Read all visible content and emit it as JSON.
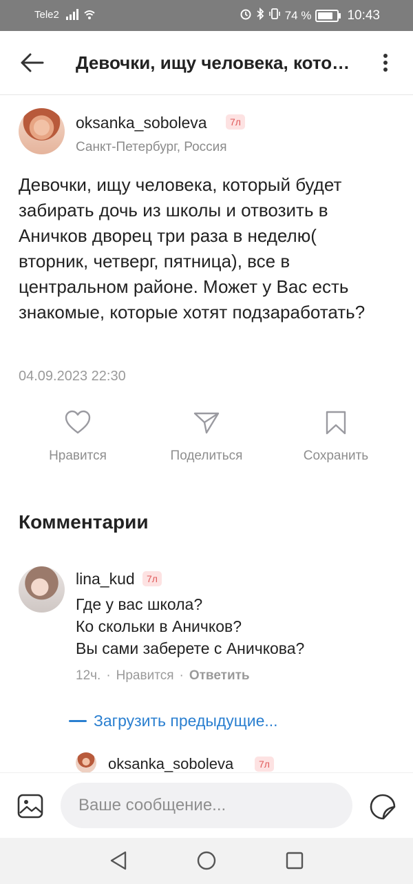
{
  "status_bar": {
    "carrier": "Tele2",
    "battery": "74 %",
    "time": "10:43"
  },
  "header": {
    "title": "Девочки, ищу человека, который будет забирать дочь из школы и отвозить в Аничков дворец три раза в неделю( вторник, четверг, пятница), все в центральном районе. Может у Вас есть знакомые, которые хотят подзаработать?"
  },
  "post": {
    "author": "oksanka_soboleva",
    "badge": "7л",
    "location": "Санкт-Петербург, Россия",
    "text": "Девочки, ищу человека, который будет забирать дочь из школы и отвозить в Аничков дворец три раза в неделю( вторник, четверг, пятница), все в центральном районе. Может у Вас есть знакомые, которые хотят подзаработать?",
    "date": "04.09.2023 22:30"
  },
  "actions": {
    "like": "Нравится",
    "share": "Поделиться",
    "save": "Сохранить"
  },
  "comments": {
    "title": "Комментарии",
    "items": [
      {
        "author": "lina_kud",
        "badge": "7л",
        "lines": [
          "Где у вас школа?",
          "Ко скольки в Аничков?",
          "Вы сами заберете с Аничкова?"
        ],
        "time": "12ч.",
        "like": "Нравится",
        "reply": "Ответить"
      }
    ],
    "load_previous": "Загрузить предыдущие...",
    "reply_preview": {
      "author": "oksanka_soboleva",
      "badge": "7л"
    }
  },
  "composer": {
    "placeholder": "Ваше сообщение..."
  },
  "icons": {
    "back": "arrow-left-icon",
    "more": "more-vertical-icon",
    "like": "heart-icon",
    "share": "paper-plane-icon",
    "save": "bookmark-icon",
    "attach": "image-icon",
    "sticker": "sticker-icon"
  },
  "colors": {
    "link": "#2a7fd0",
    "badge_bg": "#fde2e2",
    "badge_text": "#e05a5a",
    "status_bar": "#7d7d7d"
  }
}
